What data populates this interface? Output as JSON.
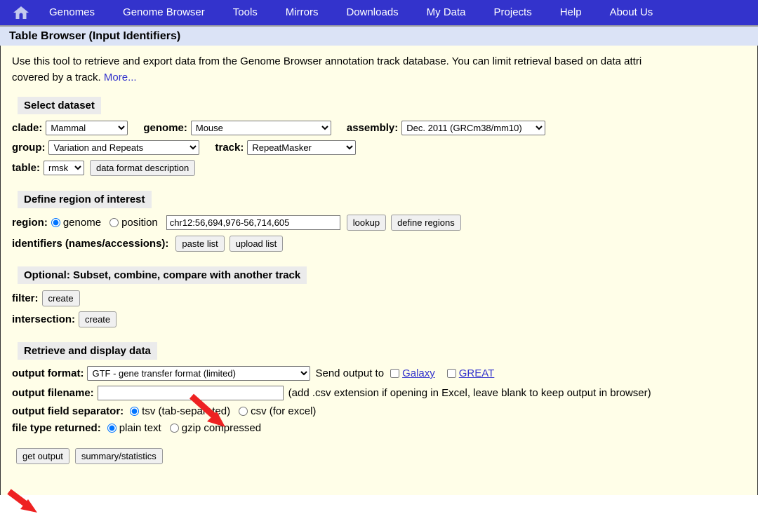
{
  "nav": {
    "home_icon": "home-icon",
    "items": [
      {
        "label": "Genomes"
      },
      {
        "label": "Genome Browser"
      },
      {
        "label": "Tools"
      },
      {
        "label": "Mirrors"
      },
      {
        "label": "Downloads"
      },
      {
        "label": "My Data"
      },
      {
        "label": "Projects"
      },
      {
        "label": "Help"
      },
      {
        "label": "About Us"
      }
    ]
  },
  "page": {
    "title": "Table Browser (Input Identifiers)",
    "intro_line1": "Use this tool to retrieve and export data from the Genome Browser annotation track database. You can limit retrieval based on data attri",
    "intro_line2": "covered by a track.",
    "more_label": "More..."
  },
  "select_dataset": {
    "heading": "Select dataset",
    "clade_label": "clade:",
    "clade_value": "Mammal",
    "genome_label": "genome:",
    "genome_value": "Mouse",
    "assembly_label": "assembly:",
    "assembly_value": "Dec. 2011 (GRCm38/mm10)",
    "group_label": "group:",
    "group_value": "Variation and Repeats",
    "track_label": "track:",
    "track_value": "RepeatMasker",
    "table_label": "table:",
    "table_value": "rmsk",
    "data_format_button": "data format description"
  },
  "region": {
    "heading": "Define region of interest",
    "region_label": "region:",
    "genome_radio_label": "genome",
    "position_radio_label": "position",
    "position_value": "chr12:56,694,976-56,714,605",
    "lookup_button": "lookup",
    "define_regions_button": "define regions",
    "identifiers_label": "identifiers (names/accessions):",
    "paste_list_button": "paste list",
    "upload_list_button": "upload list"
  },
  "subset": {
    "heading": "Optional: Subset, combine, compare with another track",
    "filter_label": "filter:",
    "filter_button": "create",
    "intersection_label": "intersection:",
    "intersection_button": "create"
  },
  "retrieve": {
    "heading": "Retrieve and display data",
    "output_format_label": "output format:",
    "output_format_value": "GTF - gene transfer format (limited)",
    "send_output_label": "Send output to",
    "galaxy_label": "Galaxy",
    "great_label": "GREAT",
    "output_filename_label": "output filename:",
    "output_filename_value": "",
    "output_filename_hint": "(add .csv extension if opening in Excel, leave blank to keep output in browser)",
    "field_separator_label": "output field separator:",
    "tsv_label": "tsv (tab-separated)",
    "csv_label": "csv (for excel)",
    "file_type_label": "file type returned:",
    "plain_text_label": "plain text",
    "gzip_label": "gzip compressed",
    "get_output_button": "get output",
    "summary_button": "summary/statistics"
  },
  "annotations": {
    "arrow_color": "#ee2222",
    "arrow_1_name": "red-arrow-output-format",
    "arrow_2_name": "red-arrow-get-output"
  },
  "colors": {
    "nav_background": "#3333cc",
    "title_background": "#dbe3f6",
    "content_background": "#fffee8",
    "link": "#3333cc",
    "section_header_background": "#ebebeb"
  }
}
